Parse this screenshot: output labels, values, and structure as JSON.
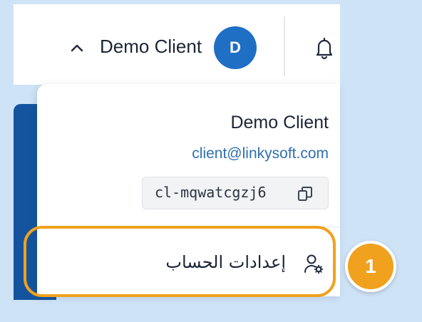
{
  "header": {
    "user_name": "Demo Client",
    "avatar_initial": "D",
    "icons": [
      "chevron-up-icon",
      "bell-icon"
    ]
  },
  "dropdown": {
    "name": "Demo Client",
    "email": "client@linkysoft.com",
    "client_id": "cl-mqwatcgzj6",
    "icons": [
      "copy-icon"
    ],
    "account_settings_label": "إعدادات الحساب",
    "account_settings_icon": "user-gear-icon"
  },
  "annotation": {
    "step_number": "1"
  },
  "colors": {
    "accent": "#1f6fc4",
    "highlight": "#f0a11e",
    "page_background": "#cfe3f7",
    "panel_blue": "#14549e",
    "email_link": "#2f6fb0"
  }
}
